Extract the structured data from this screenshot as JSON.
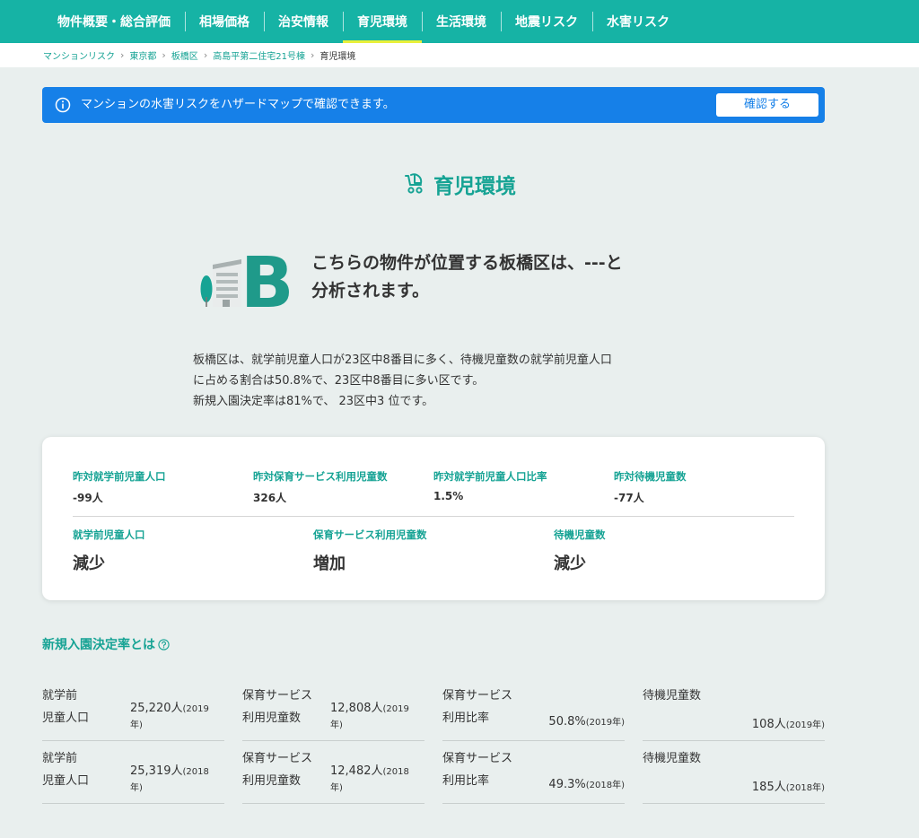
{
  "nav": {
    "tabs": [
      "物件概要・総合評価",
      "相場価格",
      "治安情報",
      "育児環境",
      "生活環境",
      "地震リスク",
      "水害リスク"
    ],
    "active_index": 3
  },
  "breadcrumb": [
    "マンションリスク",
    "東京都",
    "板橋区",
    "高島平第二住宅21号棟",
    "育児環境"
  ],
  "banner": {
    "text": "マンションの水害リスクをハザードマップで確認できます。",
    "button_label": "確認する"
  },
  "section": {
    "title": "育児環境"
  },
  "grade": {
    "letter": "B",
    "message_line1": "こちらの物件が位置する板橋区は、---と",
    "message_line2": "分析されます。"
  },
  "description": [
    "板橋区は、就学前児童人口が23区中8番目に多く、待機児童数の就学前児童人口",
    "に占める割合は50.8%で、23区中8番目に多い区です。",
    "新規入園決定率は81%で、 23区中3 位です。"
  ],
  "stats": {
    "row1": [
      {
        "label": "昨対就学前児童人口",
        "value": "-99人"
      },
      {
        "label": "昨対保育サービス利用児童数",
        "value": "326人"
      },
      {
        "label": "昨対就学前児童人口比率",
        "value": "1.5%"
      },
      {
        "label": "昨対待機児童数",
        "value": "-77人"
      }
    ],
    "row2": [
      {
        "label": "就学前児童人口",
        "value": "減少"
      },
      {
        "label": "保育サービス利用児童数",
        "value": "増加"
      },
      {
        "label": "待機児童数",
        "value": "減少"
      }
    ]
  },
  "acceptance": {
    "heading": "新規入園決定率とは",
    "rows": [
      [
        {
          "label1": "就学前",
          "label2": "児童人口",
          "value": "25,220人",
          "year_a": "(2019",
          "year_b": "年)"
        },
        {
          "label1": "保育サービス",
          "label2": "利用児童数",
          "value": "12,808人",
          "year_a": "(2019",
          "year_b": "年)"
        },
        {
          "label1": "保育サービス",
          "label2": "利用比率",
          "value": "50.8%",
          "year": "(2019年)"
        },
        {
          "label1": "待機児童数",
          "label2": "",
          "value": "108人",
          "year": "(2019年)"
        }
      ],
      [
        {
          "label1": "就学前",
          "label2": "児童人口",
          "value": "25,319人",
          "year_a": "(2018",
          "year_b": "年)"
        },
        {
          "label1": "保育サービス",
          "label2": "利用児童数",
          "value": "12,482人",
          "year_a": "(2018",
          "year_b": "年)"
        },
        {
          "label1": "保育サービス",
          "label2": "利用比率",
          "value": "49.3%",
          "year": "(2018年)"
        },
        {
          "label1": "待機児童数",
          "label2": "",
          "value": "185人",
          "year": "(2018年)"
        }
      ]
    ]
  },
  "colors": {
    "brand": "#16b3a5",
    "accent_text": "#16a394",
    "banner": "#1680e8",
    "active_tab_underline": "#e8f03a"
  },
  "icons": {
    "banner": "info-icon",
    "section": "stroller-icon",
    "help": "question-circle-icon",
    "breadcrumb_separator": "chevron-right-icon"
  }
}
